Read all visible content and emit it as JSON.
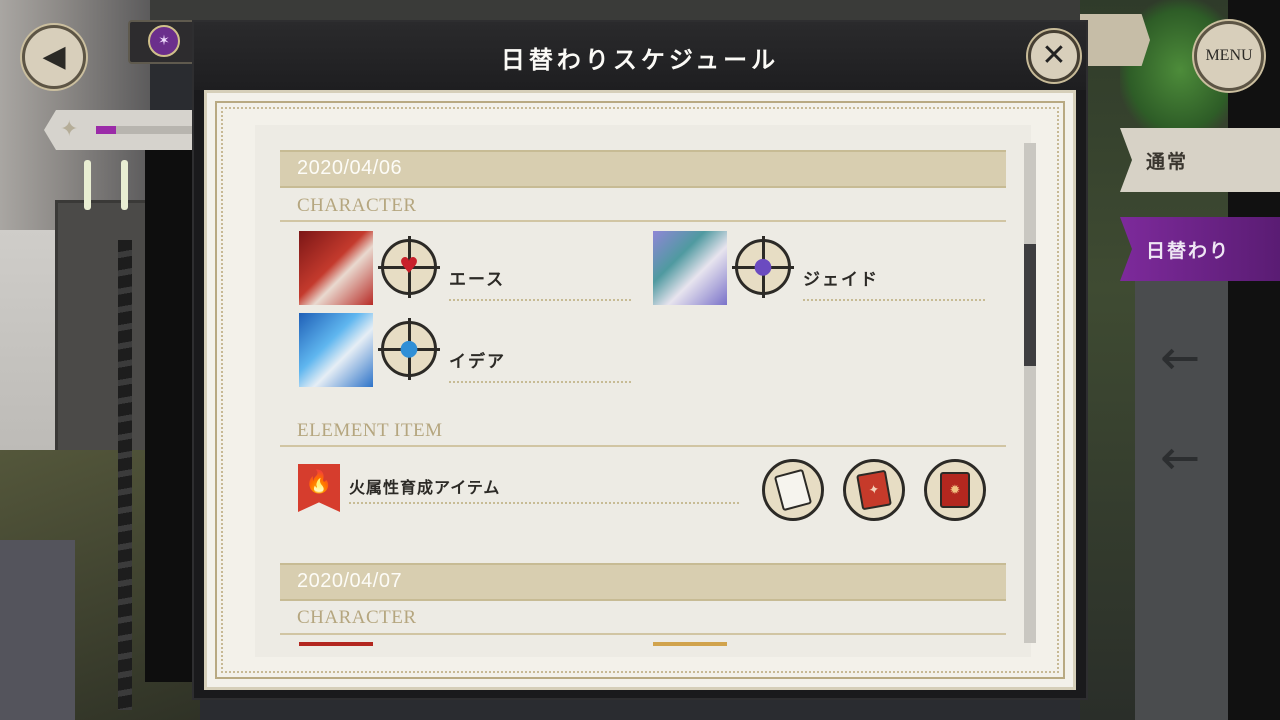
{
  "hud": {
    "back_icon": "◀",
    "gem_icon": "✶",
    "star_icon": "✦",
    "progress": 0.2,
    "menu_label": "MENU"
  },
  "side_tabs": [
    {
      "label": "通常",
      "active": false
    },
    {
      "label": "日替わり",
      "active": true
    }
  ],
  "modal": {
    "title": "日替わりスケジュール",
    "close_icon": "✕"
  },
  "schedule": [
    {
      "date": "2020/04/06",
      "character_label": "CHARACTER",
      "characters": [
        {
          "name": "エース",
          "key_color": "#c8202a",
          "key_icon": "heart-key-icon",
          "portrait_color": "#b5302b"
        },
        {
          "name": "ジェイド",
          "key_color": "#6b4bc0",
          "key_icon": "orb-key-icon",
          "portrait_color": "#7a72c9"
        },
        {
          "name": "イデア",
          "key_color": "#2f8fd6",
          "key_icon": "orb-key-icon",
          "portrait_color": "#3d8fe0"
        }
      ],
      "element_label": "ELEMENT ITEM",
      "element_item": {
        "name": "火属性育成アイテム",
        "banner_icon": "🔥",
        "items": [
          "white-book-icon",
          "red-book-icon",
          "red-gold-book-icon"
        ]
      }
    },
    {
      "date": "2020/04/07",
      "character_label": "CHARACTER"
    }
  ]
}
